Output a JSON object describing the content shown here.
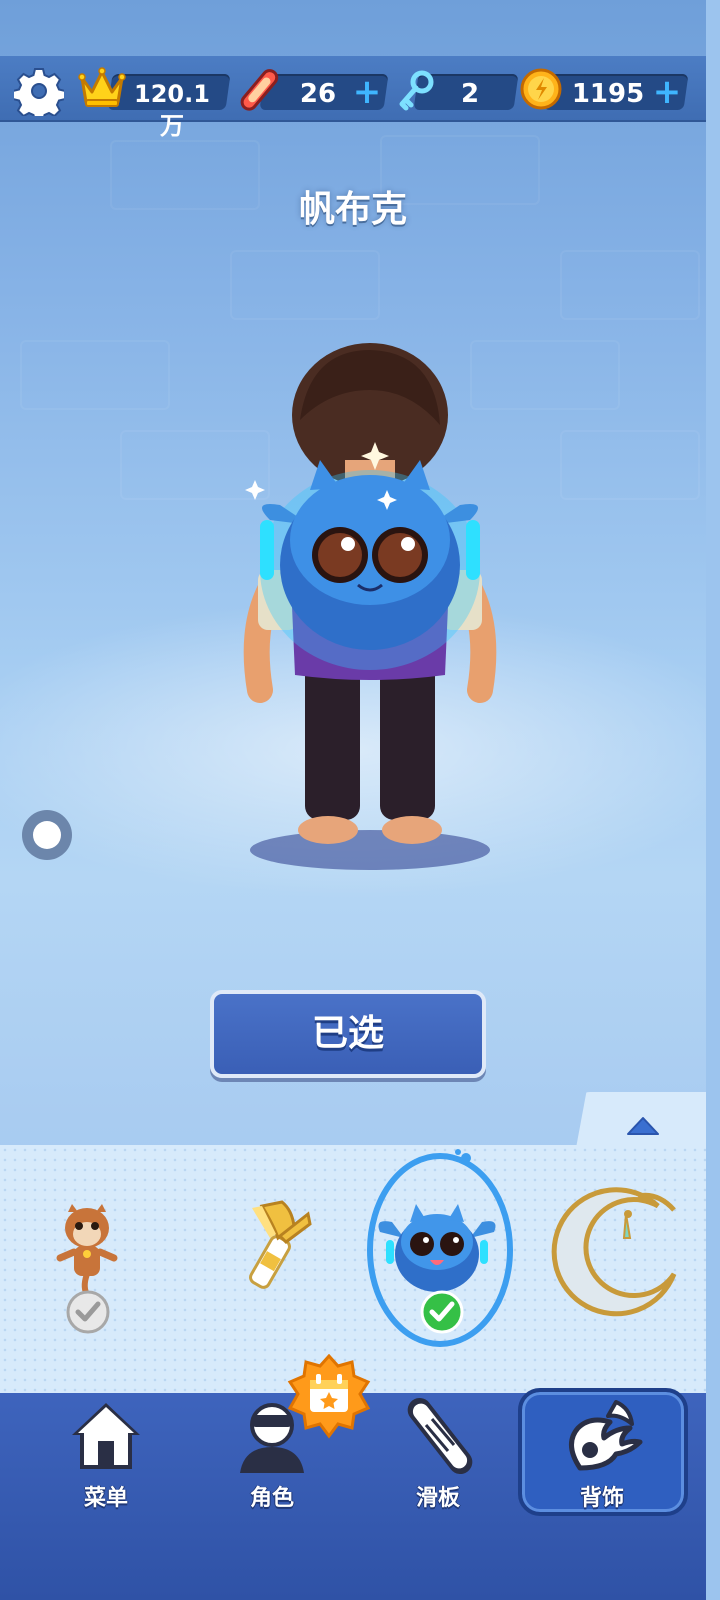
{
  "hud": {
    "score": "120.1万",
    "skateboards": "26",
    "keys": "2",
    "coins": "1195"
  },
  "item": {
    "name": "帆布克",
    "button_label": "已选"
  },
  "tray_items": [
    {
      "name": "hamster-pet",
      "status": "owned"
    },
    {
      "name": "golden-horn-accessory",
      "status": "none"
    },
    {
      "name": "blue-cat-backpack",
      "status": "selected"
    },
    {
      "name": "crescent-moon-accessory",
      "status": "none"
    }
  ],
  "tabs": [
    {
      "label": "菜单",
      "icon": "home-icon"
    },
    {
      "label": "角色",
      "icon": "character-icon"
    },
    {
      "label": "滑板",
      "icon": "skateboard-icon"
    },
    {
      "label": "背饰",
      "icon": "wing-icon",
      "active": true
    }
  ],
  "colors": {
    "accent": "#3fb6ff",
    "tab_active": "#2f5fc0",
    "selected_check": "#35c046"
  }
}
